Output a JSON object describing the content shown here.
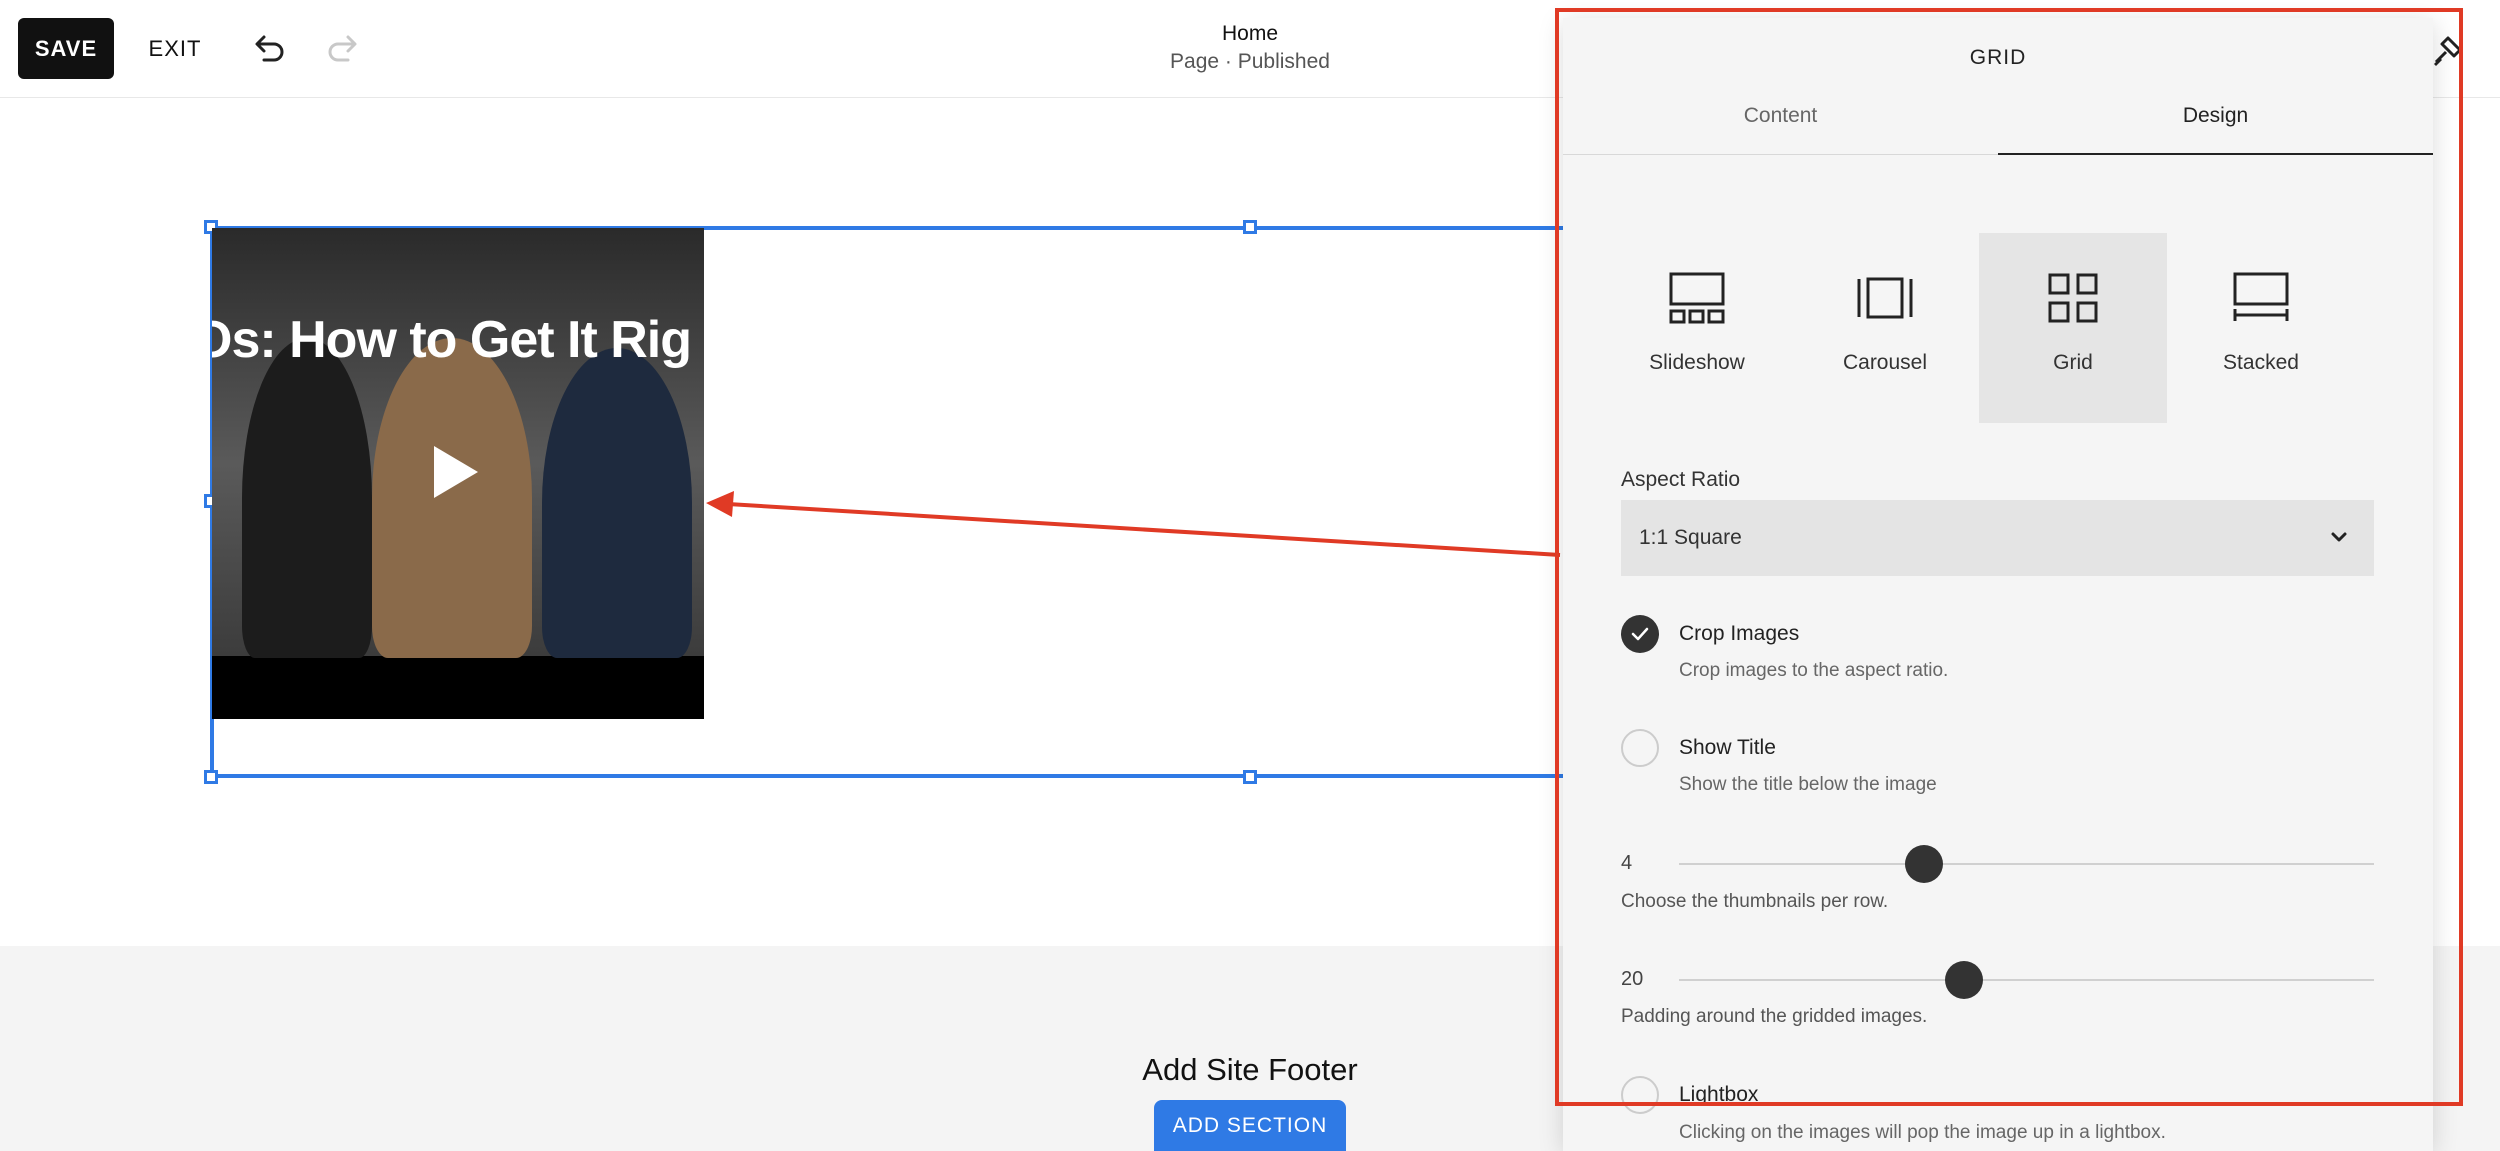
{
  "toolbar": {
    "save_label": "SAVE",
    "exit_label": "EXIT",
    "undo_icon": "undo-icon",
    "redo_icon": "redo-icon",
    "page_title": "Home",
    "page_status": "Page · Published",
    "design_icon": "paintbrush-icon"
  },
  "canvas": {
    "video_thumbnail_headline": "Os: How to Get It Rig",
    "play_icon": "play-icon"
  },
  "footer": {
    "title": "Add Site Footer",
    "add_section_label": "ADD SECTION"
  },
  "panel": {
    "title": "GRID",
    "tabs": [
      {
        "label": "Content",
        "active": false
      },
      {
        "label": "Design",
        "active": true
      }
    ],
    "layouts": [
      {
        "label": "Slideshow",
        "icon": "slideshow-icon",
        "active": false
      },
      {
        "label": "Carousel",
        "icon": "carousel-icon",
        "active": false
      },
      {
        "label": "Grid",
        "icon": "grid-icon",
        "active": true
      },
      {
        "label": "Stacked",
        "icon": "stacked-icon",
        "active": false
      }
    ],
    "aspect_ratio": {
      "label": "Aspect Ratio",
      "value": "1:1 Square"
    },
    "crop_images": {
      "title": "Crop Images",
      "description": "Crop images to the aspect ratio.",
      "checked": true
    },
    "show_title": {
      "title": "Show Title",
      "description": "Show the title below the image",
      "checked": false
    },
    "thumbnails_per_row": {
      "value": "4",
      "description": "Choose the thumbnails per row.",
      "fraction": 0.352
    },
    "padding": {
      "value": "20",
      "description": "Padding around the gridded images.",
      "fraction": 0.41
    },
    "lightbox": {
      "title": "Lightbox",
      "description": "Clicking on the images will pop the image up in a lightbox.",
      "checked": false
    }
  },
  "colors": {
    "selection": "#2f7ae5",
    "annotation": "#e03a25",
    "primary_button": "#2f7ae5"
  }
}
